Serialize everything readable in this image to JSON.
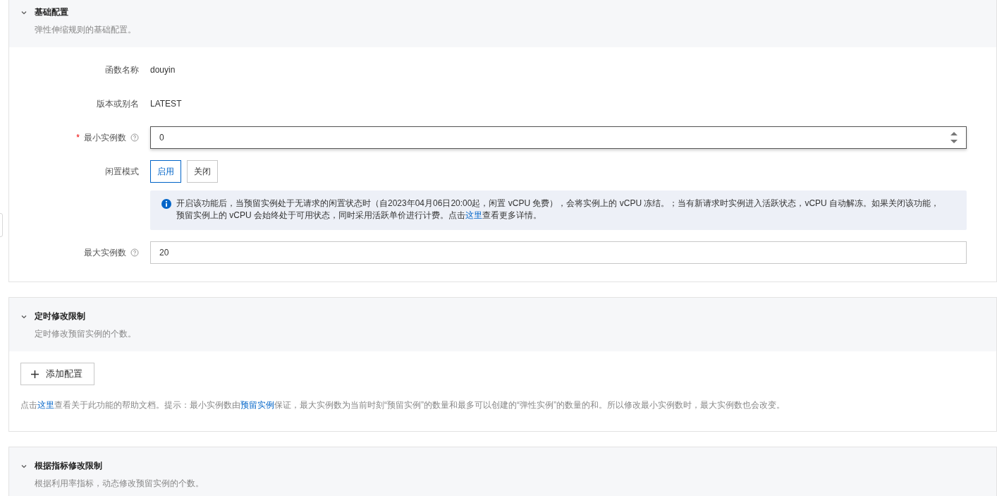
{
  "basic": {
    "title": "基础配置",
    "description": "弹性伸缩规则的基础配置。",
    "expanded": true,
    "fields": [
      {
        "kind": "text",
        "label": "函数名称",
        "value": "douyin"
      },
      {
        "kind": "text",
        "label": "版本或别名",
        "value": "LATEST"
      },
      {
        "kind": "number",
        "label": "最小实例数",
        "required_mark": "*",
        "help": true,
        "value": "0",
        "focused": true
      },
      {
        "kind": "toggle",
        "label": "闲置模式",
        "options": [
          {
            "label": "启用",
            "selected": true
          },
          {
            "label": "关闭",
            "selected": false
          }
        ],
        "notice": [
          {
            "text": "开启该功能后，当预留实例处于无请求的闲置状态时（自2023年04月06日20:00起，闲置 vCPU 免费），会将实例上的 vCPU 冻结。；当有新请求时实例进入活跃状态，vCPU 自动解冻。如果关闭该功能，预留实例上的 vCPU 会始终处于可用状态，同时采用活跃单价进行计费。点击",
            "link": false
          },
          {
            "text": "这里",
            "link": true
          },
          {
            "text": "查看更多详情。",
            "link": false
          }
        ]
      },
      {
        "kind": "input",
        "label": "最大实例数",
        "help": true,
        "value": "20",
        "focused": false
      }
    ]
  },
  "schedule": {
    "title": "定时修改限制",
    "description": "定时修改预留实例的个数。",
    "expanded": true,
    "add_button": "添加配置",
    "help_text": [
      {
        "text": "点击",
        "link": false
      },
      {
        "text": "这里",
        "link": true
      },
      {
        "text": "查看关于此功能的帮助文档。提示：最小实例数由",
        "link": false
      },
      {
        "text": "预留实例",
        "link": true
      },
      {
        "text": "保证，最大实例数为当前时刻“预留实例”的数量和最多可以创建的“弹性实例”的数量的和。所以修改最小实例数时，最大实例数也会改变。",
        "link": false
      }
    ]
  },
  "metric": {
    "title": "根据指标修改限制",
    "description": "根据利用率指标，动态修改预留实例的个数。",
    "expanded": true
  }
}
